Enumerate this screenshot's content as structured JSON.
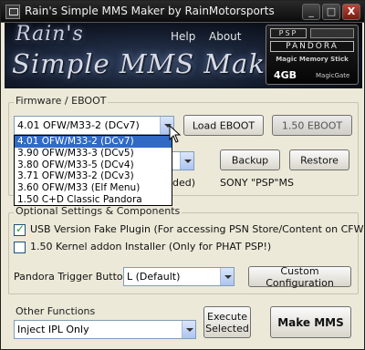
{
  "window": {
    "title": "Rain's Simple MMS Maker by RainMotorsports"
  },
  "titlebar_buttons": {
    "minimize": "_",
    "maximize": "□",
    "close": "X"
  },
  "banner": {
    "line1": "Rain's",
    "line2": "Simple MMS Maker",
    "menu": {
      "help": "Help",
      "about": "About"
    },
    "card": {
      "psp": "PSP",
      "pandora": "PANDORA",
      "mms": "Magic Memory Stick",
      "size": "4GB",
      "gate": "MagicGate"
    }
  },
  "firmware": {
    "group_label": "Firmware / EBOOT",
    "selected": "4.01 OFW/M33-2 (DCv7)",
    "options": [
      "4.01 OFW/M33-2 (DCv7)",
      "3.90 OFW/M33-3 (DCv5)",
      "3.80 OFW/M33-5 (DCv4)",
      "3.71 OFW/M33-2 (DCv3)",
      "3.60 OFW/M33 (Elf Menu)",
      "1.50 C+D Classic Pandora"
    ],
    "load_eboot": "Load EBOOT",
    "eboot_150": "1.50 EBOOT",
    "backup": "Backup",
    "restore": "Restore",
    "partial_text": "ded)",
    "device_text": "SONY \"PSP\"MS"
  },
  "optional": {
    "group_label": "Optional Settings & Components",
    "usb_plugin": {
      "label": "USB Version Fake Plugin  (For accessing PSN Store/Content on CFW)",
      "checked": true
    },
    "kernel_addon": {
      "label": "1.50 Kernel addon Installer (Only for PHAT PSP!)",
      "checked": false
    },
    "trigger_label": "Pandora Trigger Button",
    "trigger_value": "L (Default)",
    "custom_config": "Custom Configuration"
  },
  "other": {
    "group_label": "Other Functions",
    "value": "Inject IPL Only",
    "execute": "Execute Selected",
    "make_mms": "Make MMS"
  }
}
